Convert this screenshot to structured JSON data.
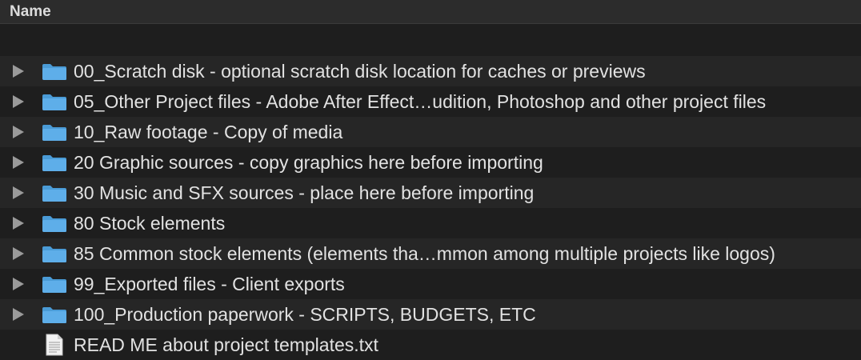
{
  "header": {
    "name_column": "Name"
  },
  "rows": [
    {
      "label": "00_Scratch disk - optional scratch disk location for caches or previews",
      "icon": "folder-icon",
      "expandable": true
    },
    {
      "label": "05_Other Project files - Adobe After Effect…udition, Photoshop and other project files",
      "icon": "folder-icon",
      "expandable": true
    },
    {
      "label": "10_Raw footage  - Copy of media",
      "icon": "folder-icon",
      "expandable": true
    },
    {
      "label": "20 Graphic sources - copy graphics here before importing",
      "icon": "folder-icon",
      "expandable": true
    },
    {
      "label": "30 Music and SFX sources - place here before importing",
      "icon": "folder-icon",
      "expandable": true
    },
    {
      "label": "80 Stock elements",
      "icon": "folder-icon",
      "expandable": true
    },
    {
      "label": "85 Common stock elements (elements tha…mmon among multiple projects like logos)",
      "icon": "folder-icon",
      "expandable": true
    },
    {
      "label": "99_Exported files -  Client exports",
      "icon": "folder-icon",
      "expandable": true
    },
    {
      "label": "100_Production paperwork - SCRIPTS, BUDGETS, ETC",
      "icon": "folder-icon",
      "expandable": true
    },
    {
      "label": "READ ME about project templates.txt",
      "icon": "text-file-icon",
      "expandable": false
    }
  ],
  "colors": {
    "folder": "#5eaee9",
    "folder_tab": "#4a9bd6",
    "background": "#1e1e1e",
    "alt_row": "#262626"
  }
}
